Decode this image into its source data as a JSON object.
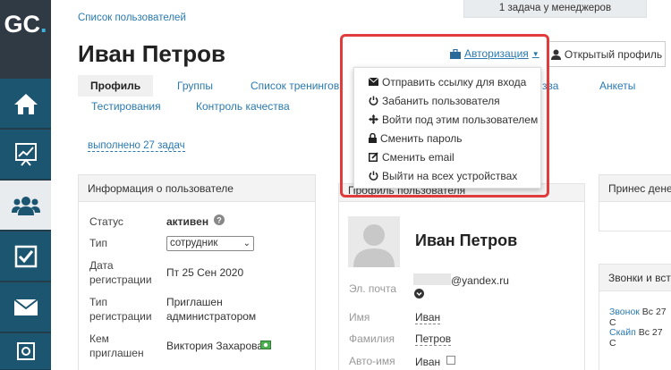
{
  "brand": {
    "logo_main": "GC",
    "logo_dot": "."
  },
  "sidebar": {
    "items": [
      {
        "icon": "home-icon"
      },
      {
        "icon": "chart-icon"
      },
      {
        "icon": "users-icon"
      },
      {
        "icon": "checkbox-icon"
      },
      {
        "icon": "mail-icon"
      },
      {
        "icon": "settings-icon"
      }
    ]
  },
  "topbar": {
    "task_notice": "1 задача у менеджеров"
  },
  "breadcrumb": "Список пользователей",
  "page_title": "Иван Петров",
  "header": {
    "auth_label": "Авторизация",
    "open_profile_label": "Открытый профиль"
  },
  "tabs": [
    {
      "label": "Профиль"
    },
    {
      "label": "Группы"
    },
    {
      "label": "Список тренингов"
    },
    {
      "label": "зва"
    },
    {
      "label": "Анкеты"
    },
    {
      "label": "Тестирования"
    },
    {
      "label": "Контроль качества"
    }
  ],
  "done_tasks": "выполнено 27 задач",
  "auth_menu": [
    {
      "label": "Отправить ссылку для входа",
      "icon": "envelope-icon"
    },
    {
      "label": "Забанить пользователя",
      "icon": "power-icon"
    },
    {
      "label": "Войти под этим пользователем",
      "icon": "move-icon"
    },
    {
      "label": "Сменить пароль",
      "icon": "lock-icon"
    },
    {
      "label": "Сменить email",
      "icon": "edit-icon"
    },
    {
      "label": "Выйти на всех устройствах",
      "icon": "power-icon"
    }
  ],
  "user_info": {
    "title": "Информация о пользователе",
    "status_label": "Статус",
    "status_value": "активен",
    "type_label": "Тип",
    "type_value": "сотрудник",
    "reg_date_label_1": "Дата",
    "reg_date_label_2": "регистрации",
    "reg_date_value": "Пт 25 Сен 2020",
    "reg_type_label_1": "Тип",
    "reg_type_label_2": "регистрации",
    "reg_type_value_1": "Приглашен",
    "reg_type_value_2": "администратором",
    "invited_label_1": "Кем",
    "invited_label_2": "приглашен",
    "invited_value": "Виктория Захарова"
  },
  "profile": {
    "title": "Профиль пользователя",
    "name": "Иван Петров",
    "email_label": "Эл. почта",
    "email_value": "@yandex.ru",
    "first_name_label": "Имя",
    "first_name_value": "Иван",
    "last_name_label": "Фамилия",
    "last_name_value": "Петров",
    "auto_name_label": "Авто-имя",
    "auto_name_value": "Иван"
  },
  "right_panels": {
    "brought_title": "Принес дене",
    "calls_title": "Звонки и встр",
    "calls": [
      {
        "type": "Звонок",
        "date": "Вс 27 С"
      },
      {
        "type": "Скайп",
        "date": "Вс 27 С"
      }
    ]
  },
  "colors": {
    "accent": "#2a7ab0",
    "sidebar_bg": "#1b5570",
    "highlight": "#e03c3c"
  }
}
